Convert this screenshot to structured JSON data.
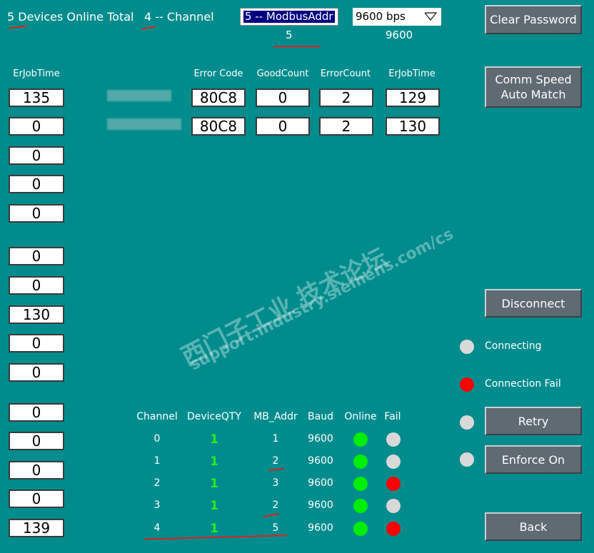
{
  "header": {
    "devices_online": "5 Devices Online Total",
    "channel": "4 -- Channel",
    "modbus_select": "5 -- ModbusAddr",
    "modbus_value": "5",
    "baud_select": "9600 bps",
    "baud_value": "9600"
  },
  "left_column": {
    "header": "ErJobTime",
    "values": [
      "135",
      "0",
      "0",
      "0",
      "0",
      "0",
      "0",
      "130",
      "0",
      "0",
      "0",
      "0",
      "0",
      "0",
      "139"
    ]
  },
  "error_table": {
    "headers": [
      "Error Code",
      "GoodCount",
      "ErrorCount",
      "ErJobTime"
    ],
    "rows": [
      [
        "80C8",
        "0",
        "2",
        "129"
      ],
      [
        "80C8",
        "0",
        "2",
        "130"
      ]
    ]
  },
  "buttons": {
    "clear_password": "Clear Password",
    "comm_speed": "Comm Speed Auto Match",
    "disconnect": "Disconnect",
    "retry": "Retry",
    "enforce_on": "Enforce On",
    "back": "Back"
  },
  "status": {
    "connecting": "Connecting",
    "connection_fail": "Connection Fail"
  },
  "channel_table": {
    "headers": [
      "Channel",
      "DeviceQTY",
      "MB_Addr",
      "Baud",
      "Online",
      "Fail"
    ],
    "rows": [
      {
        "channel": "0",
        "qty": "1",
        "addr": "1",
        "baud": "9600",
        "online": "#00ee00",
        "fail": "#d9d9d9"
      },
      {
        "channel": "1",
        "qty": "1",
        "addr": "2",
        "baud": "9600",
        "online": "#00ee00",
        "fail": "#d9d9d9"
      },
      {
        "channel": "2",
        "qty": "1",
        "addr": "3",
        "baud": "9600",
        "online": "#00ee00",
        "fail": "#ff0000"
      },
      {
        "channel": "3",
        "qty": "1",
        "addr": "2",
        "baud": "9600",
        "online": "#00ee00",
        "fail": "#d9d9d9"
      },
      {
        "channel": "4",
        "qty": "1",
        "addr": "5",
        "baud": "9600",
        "online": "#00ee00",
        "fail": "#ff0000"
      }
    ]
  },
  "indicator_colors": {
    "grey": "#d9d9d9",
    "red": "#ff0000",
    "green": "#00ee00"
  },
  "watermark": {
    "line1": "西门子工业 技术论坛",
    "line2": "support.industry.siemens.com/cs"
  }
}
